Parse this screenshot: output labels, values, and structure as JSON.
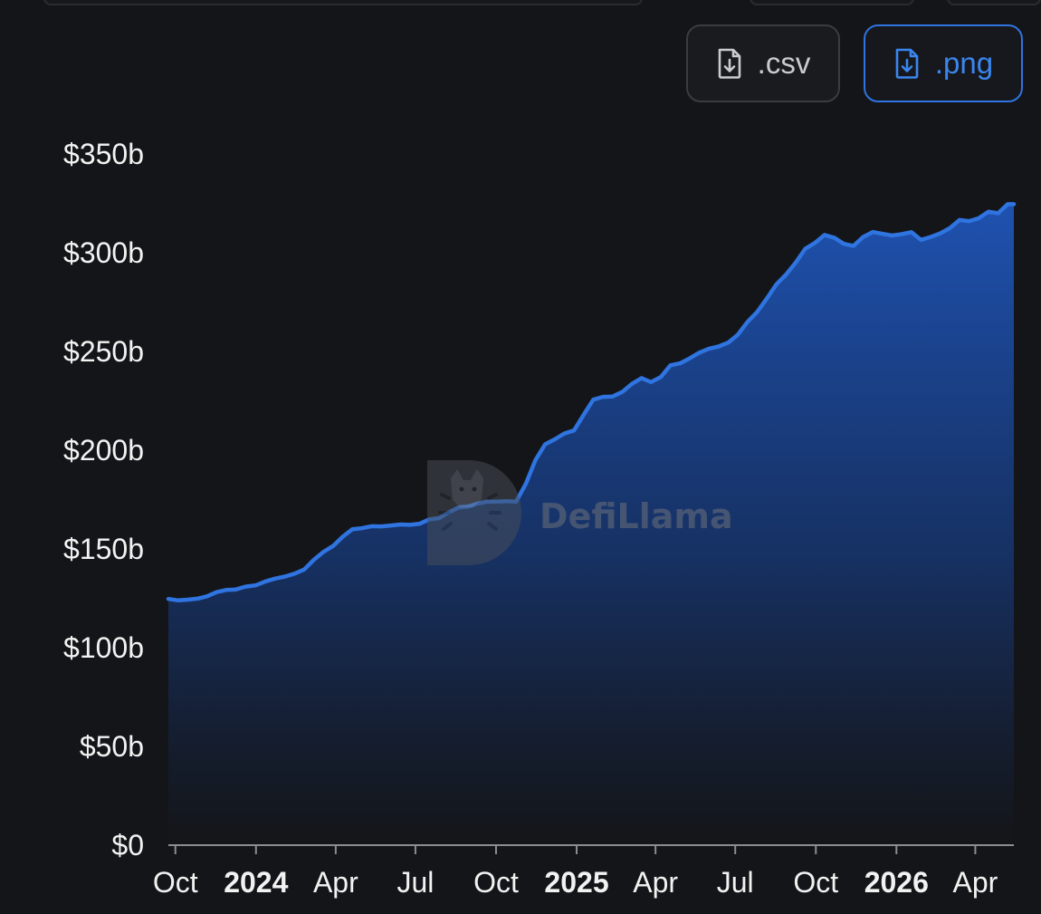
{
  "toolbar": {
    "csv_label": ".csv",
    "png_label": ".png",
    "csv_icon": "file-download-icon",
    "png_icon": "file-download-icon",
    "accent": "#2f74e0"
  },
  "watermark": {
    "text": "DefiLlama",
    "icon": "defillama-logo-icon"
  },
  "chart_data": {
    "type": "area",
    "title": "",
    "xlabel": "",
    "ylabel": "",
    "y_unit": "$ billions",
    "ylim": [
      0,
      350
    ],
    "y_ticks": [
      0,
      50,
      100,
      150,
      200,
      250,
      300,
      350
    ],
    "y_tick_labels": [
      "$0",
      "$50b",
      "$100b",
      "$150b",
      "$200b",
      "$250b",
      "$300b",
      "$350b"
    ],
    "x_range": [
      "2023-09-23",
      "2026-05-15"
    ],
    "x_ticks": [
      {
        "date": "2023-10-01",
        "label": "Oct",
        "bold": false
      },
      {
        "date": "2024-01-01",
        "label": "2024",
        "bold": true
      },
      {
        "date": "2024-04-01",
        "label": "Apr",
        "bold": false
      },
      {
        "date": "2024-07-01",
        "label": "Jul",
        "bold": false
      },
      {
        "date": "2024-10-01",
        "label": "Oct",
        "bold": false
      },
      {
        "date": "2025-01-01",
        "label": "2025",
        "bold": true
      },
      {
        "date": "2025-04-01",
        "label": "Apr",
        "bold": false
      },
      {
        "date": "2025-07-01",
        "label": "Jul",
        "bold": false
      },
      {
        "date": "2025-10-01",
        "label": "Oct",
        "bold": false
      },
      {
        "date": "2026-01-01",
        "label": "2026",
        "bold": true
      },
      {
        "date": "2026-04-01",
        "label": "Apr",
        "bold": false
      }
    ],
    "grid": false,
    "line_color": "#2f74e0",
    "fill_color": "#1f55b8",
    "series": [
      {
        "points": [
          [
            "2023-09-23",
            124.7
          ],
          [
            "2023-10-04",
            124.0
          ],
          [
            "2023-10-15",
            124.3
          ],
          [
            "2023-10-26",
            124.8
          ],
          [
            "2023-11-06",
            126.0
          ],
          [
            "2023-11-17",
            128.1
          ],
          [
            "2023-11-28",
            129.2
          ],
          [
            "2023-12-09",
            129.5
          ],
          [
            "2023-12-20",
            130.9
          ],
          [
            "2024-01-01",
            131.6
          ],
          [
            "2024-01-12",
            133.6
          ],
          [
            "2024-01-23",
            135.0
          ],
          [
            "2024-02-03",
            136.0
          ],
          [
            "2024-02-14",
            137.5
          ],
          [
            "2024-02-25",
            139.6
          ],
          [
            "2024-03-07",
            144.5
          ],
          [
            "2024-03-18",
            148.5
          ],
          [
            "2024-03-29",
            151.5
          ],
          [
            "2024-04-09",
            156.2
          ],
          [
            "2024-04-20",
            160.0
          ],
          [
            "2024-05-01",
            160.5
          ],
          [
            "2024-05-12",
            161.5
          ],
          [
            "2024-05-23",
            161.4
          ],
          [
            "2024-06-03",
            161.9
          ],
          [
            "2024-06-14",
            162.4
          ],
          [
            "2024-06-25",
            162.2
          ],
          [
            "2024-07-06",
            162.8
          ],
          [
            "2024-07-17",
            165.0
          ],
          [
            "2024-07-28",
            165.6
          ],
          [
            "2024-08-08",
            168.5
          ],
          [
            "2024-08-19",
            171.0
          ],
          [
            "2024-08-30",
            171.4
          ],
          [
            "2024-09-10",
            173.0
          ],
          [
            "2024-09-21",
            174.0
          ],
          [
            "2024-10-02",
            174.0
          ],
          [
            "2024-10-13",
            174.2
          ],
          [
            "2024-10-24",
            174.0
          ],
          [
            "2024-11-04",
            183.0
          ],
          [
            "2024-11-15",
            195.0
          ],
          [
            "2024-11-26",
            203.0
          ],
          [
            "2024-12-07",
            205.5
          ],
          [
            "2024-12-18",
            208.5
          ],
          [
            "2024-12-29",
            210.0
          ],
          [
            "2025-01-09",
            218.0
          ],
          [
            "2025-01-20",
            225.6
          ],
          [
            "2025-01-31",
            227.0
          ],
          [
            "2025-02-11",
            227.2
          ],
          [
            "2025-02-22",
            229.5
          ],
          [
            "2025-03-05",
            233.6
          ],
          [
            "2025-03-16",
            236.5
          ],
          [
            "2025-03-27",
            234.5
          ],
          [
            "2025-04-07",
            237.0
          ],
          [
            "2025-04-18",
            243.0
          ],
          [
            "2025-04-29",
            244.0
          ],
          [
            "2025-05-10",
            246.5
          ],
          [
            "2025-05-21",
            249.4
          ],
          [
            "2025-06-01",
            251.4
          ],
          [
            "2025-06-12",
            252.5
          ],
          [
            "2025-06-23",
            254.5
          ],
          [
            "2025-07-04",
            258.5
          ],
          [
            "2025-07-15",
            265.0
          ],
          [
            "2025-07-26",
            270.0
          ],
          [
            "2025-08-06",
            276.8
          ],
          [
            "2025-08-17",
            284.0
          ],
          [
            "2025-08-28",
            289.0
          ],
          [
            "2025-09-08",
            295.0
          ],
          [
            "2025-09-19",
            302.0
          ],
          [
            "2025-09-30",
            305.0
          ],
          [
            "2025-10-11",
            309.0
          ],
          [
            "2025-10-22",
            307.6
          ],
          [
            "2025-11-02",
            304.5
          ],
          [
            "2025-11-13",
            303.5
          ],
          [
            "2025-11-24",
            308.0
          ],
          [
            "2025-12-05",
            310.5
          ],
          [
            "2025-12-16",
            309.6
          ],
          [
            "2025-12-27",
            308.7
          ],
          [
            "2026-01-07",
            309.4
          ],
          [
            "2026-01-18",
            310.4
          ],
          [
            "2026-01-29",
            306.5
          ],
          [
            "2026-02-09",
            308.0
          ],
          [
            "2026-02-20",
            309.8
          ],
          [
            "2026-03-03",
            312.5
          ],
          [
            "2026-03-14",
            316.6
          ],
          [
            "2026-03-25",
            316.0
          ],
          [
            "2026-04-05",
            317.5
          ],
          [
            "2026-04-16",
            320.8
          ],
          [
            "2026-04-27",
            320.0
          ],
          [
            "2026-05-08",
            324.6
          ],
          [
            "2026-05-15",
            324.6
          ]
        ]
      }
    ]
  }
}
